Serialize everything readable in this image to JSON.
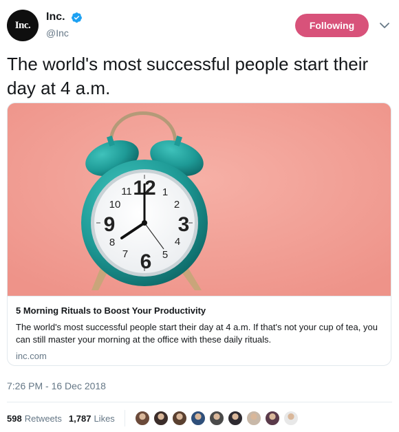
{
  "account": {
    "avatar_text": "Inc.",
    "display_name": "Inc.",
    "handle": "@Inc",
    "verified": true
  },
  "follow_button": {
    "label": "Following",
    "color": "#d8527a"
  },
  "tweet": {
    "text": "The world's most successful people start their day at 4 a.m.",
    "timestamp": "7:26 PM - 16 Dec 2018"
  },
  "card": {
    "image_description_icon": "alarm-clock",
    "title": "5 Morning Rituals to Boost Your Productivity",
    "description": "The world's most successful people start their day at 4 a.m. If that's not your cup of tea, you can still master your morning at the office with these daily rituals.",
    "domain": "inc.com",
    "clock_numbers": [
      "12",
      "1",
      "2",
      "3",
      "4",
      "5",
      "6",
      "7",
      "8",
      "9",
      "10",
      "11"
    ]
  },
  "stats": {
    "retweets_count": "598",
    "retweets_label": "Retweets",
    "likes_count": "1,787",
    "likes_label": "Likes"
  },
  "likers": [
    "#6b4a3a",
    "#3b2d2a",
    "#5a4030",
    "#2f4f7a",
    "#4a4a4a",
    "#2e2a30",
    "#c8b8a8",
    "#5a3a4a",
    "#e8e8e8"
  ],
  "colors": {
    "accent_blue": "#1da1f2",
    "text_secondary": "#657786",
    "card_bg": "#f29f97",
    "clock_teal": "#1e9a96"
  }
}
